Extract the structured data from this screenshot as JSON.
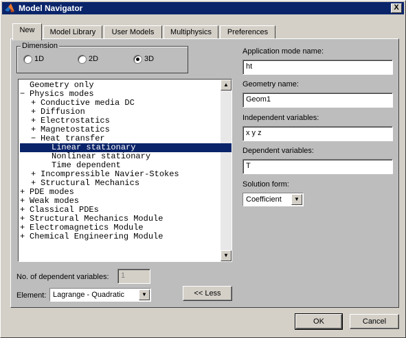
{
  "window": {
    "title": "Model Navigator",
    "close_symbol": "X"
  },
  "tabs": [
    {
      "label": "New",
      "active": true
    },
    {
      "label": "Model Library",
      "active": false
    },
    {
      "label": "User Models",
      "active": false
    },
    {
      "label": "Multiphysics",
      "active": false
    },
    {
      "label": "Preferences",
      "active": false
    }
  ],
  "dimension": {
    "legend": "Dimension",
    "options": [
      {
        "label": "1D",
        "selected": false
      },
      {
        "label": "2D",
        "selected": false
      },
      {
        "label": "3D",
        "selected": true
      }
    ]
  },
  "tree": {
    "items": [
      {
        "text": "Geometry only",
        "prefix": "  ",
        "indent": 0,
        "selected": false
      },
      {
        "text": "Physics modes",
        "prefix": "− ",
        "indent": 0,
        "selected": false
      },
      {
        "text": "Conductive media DC",
        "prefix": "+ ",
        "indent": 1,
        "selected": false
      },
      {
        "text": "Diffusion",
        "prefix": "+ ",
        "indent": 1,
        "selected": false
      },
      {
        "text": "Electrostatics",
        "prefix": "+ ",
        "indent": 1,
        "selected": false
      },
      {
        "text": "Magnetostatics",
        "prefix": "+ ",
        "indent": 1,
        "selected": false
      },
      {
        "text": "Heat transfer",
        "prefix": "− ",
        "indent": 1,
        "selected": false
      },
      {
        "text": "Linear stationary",
        "prefix": "  ",
        "indent": 2,
        "selected": true
      },
      {
        "text": "Nonlinear stationary",
        "prefix": "  ",
        "indent": 2,
        "selected": false
      },
      {
        "text": "Time dependent",
        "prefix": "  ",
        "indent": 2,
        "selected": false
      },
      {
        "text": "Incompressible Navier-Stokes",
        "prefix": "+ ",
        "indent": 1,
        "selected": false
      },
      {
        "text": "Structural Mechanics",
        "prefix": "+ ",
        "indent": 1,
        "selected": false
      },
      {
        "text": "PDE modes",
        "prefix": "+ ",
        "indent": 0,
        "selected": false
      },
      {
        "text": "Weak modes",
        "prefix": "+ ",
        "indent": 0,
        "selected": false
      },
      {
        "text": "Classical PDEs",
        "prefix": "+ ",
        "indent": 0,
        "selected": false
      },
      {
        "text": "Structural Mechanics Module",
        "prefix": "+ ",
        "indent": 0,
        "selected": false
      },
      {
        "text": "Electromagnetics Module",
        "prefix": "+ ",
        "indent": 0,
        "selected": false
      },
      {
        "text": "Chemical Engineering Module",
        "prefix": "+ ",
        "indent": 0,
        "selected": false
      }
    ]
  },
  "left_fields": {
    "num_dep_vars_label": "No. of dependent variables:",
    "num_dep_vars_value": "1",
    "element_label": "Element:",
    "element_value": "Lagrange - Quadratic",
    "less_button": "<< Less"
  },
  "right_fields": {
    "app_mode_label": "Application mode name:",
    "app_mode_value": "ht",
    "geometry_label": "Geometry name:",
    "geometry_value": "Geom1",
    "indep_label": "Independent variables:",
    "indep_value": "x y z",
    "dep_label": "Dependent variables:",
    "dep_value": "T",
    "solution_form_label": "Solution form:",
    "solution_form_value": "Coefficient"
  },
  "footer": {
    "ok": "OK",
    "cancel": "Cancel"
  },
  "icons": {
    "app": "matlab-logo-icon",
    "dropdown": "chevron-down-icon",
    "scroll_up": "arrow-up-icon",
    "scroll_down": "arrow-down-icon"
  },
  "colors": {
    "titlebar": "#0a246a",
    "selection": "#0a246a",
    "panel": "#bdbdbd",
    "face": "#d4d0c8"
  }
}
